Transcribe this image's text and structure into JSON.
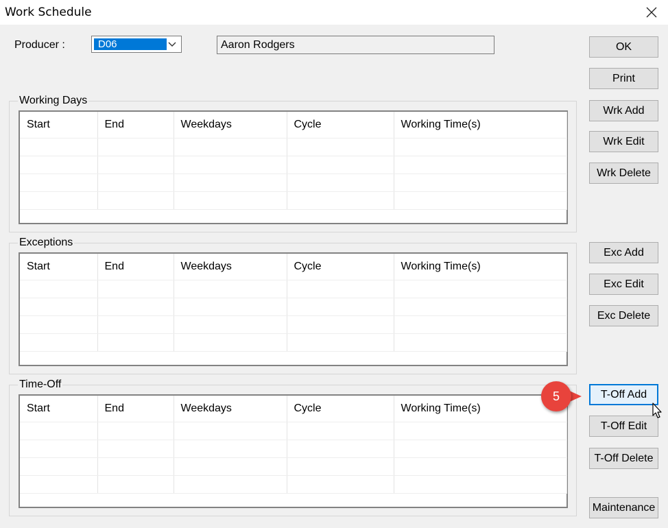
{
  "window": {
    "title": "Work Schedule",
    "close_icon": "close-icon"
  },
  "producer": {
    "label": "Producer :",
    "selected": "D06",
    "name": "Aaron Rodgers"
  },
  "columns": [
    "Start",
    "End",
    "Weekdays",
    "Cycle",
    "Working Time(s)"
  ],
  "groups": {
    "working_days": {
      "title": "Working Days"
    },
    "exceptions": {
      "title": "Exceptions"
    },
    "time_off": {
      "title": "Time-Off"
    }
  },
  "buttons": {
    "ok": "OK",
    "print": "Print",
    "wrk_add": "Wrk Add",
    "wrk_edit": "Wrk Edit",
    "wrk_delete": "Wrk Delete",
    "exc_add": "Exc Add",
    "exc_edit": "Exc Edit",
    "exc_delete": "Exc Delete",
    "toff_add": "T-Off Add",
    "toff_edit": "T-Off Edit",
    "toff_delete": "T-Off Delete",
    "maintenance": "Maintenance"
  },
  "callout": {
    "step": "5",
    "color": "#e8433c"
  },
  "colors": {
    "selection": "#0078d7",
    "dialog_bg": "#f0f0f0"
  }
}
